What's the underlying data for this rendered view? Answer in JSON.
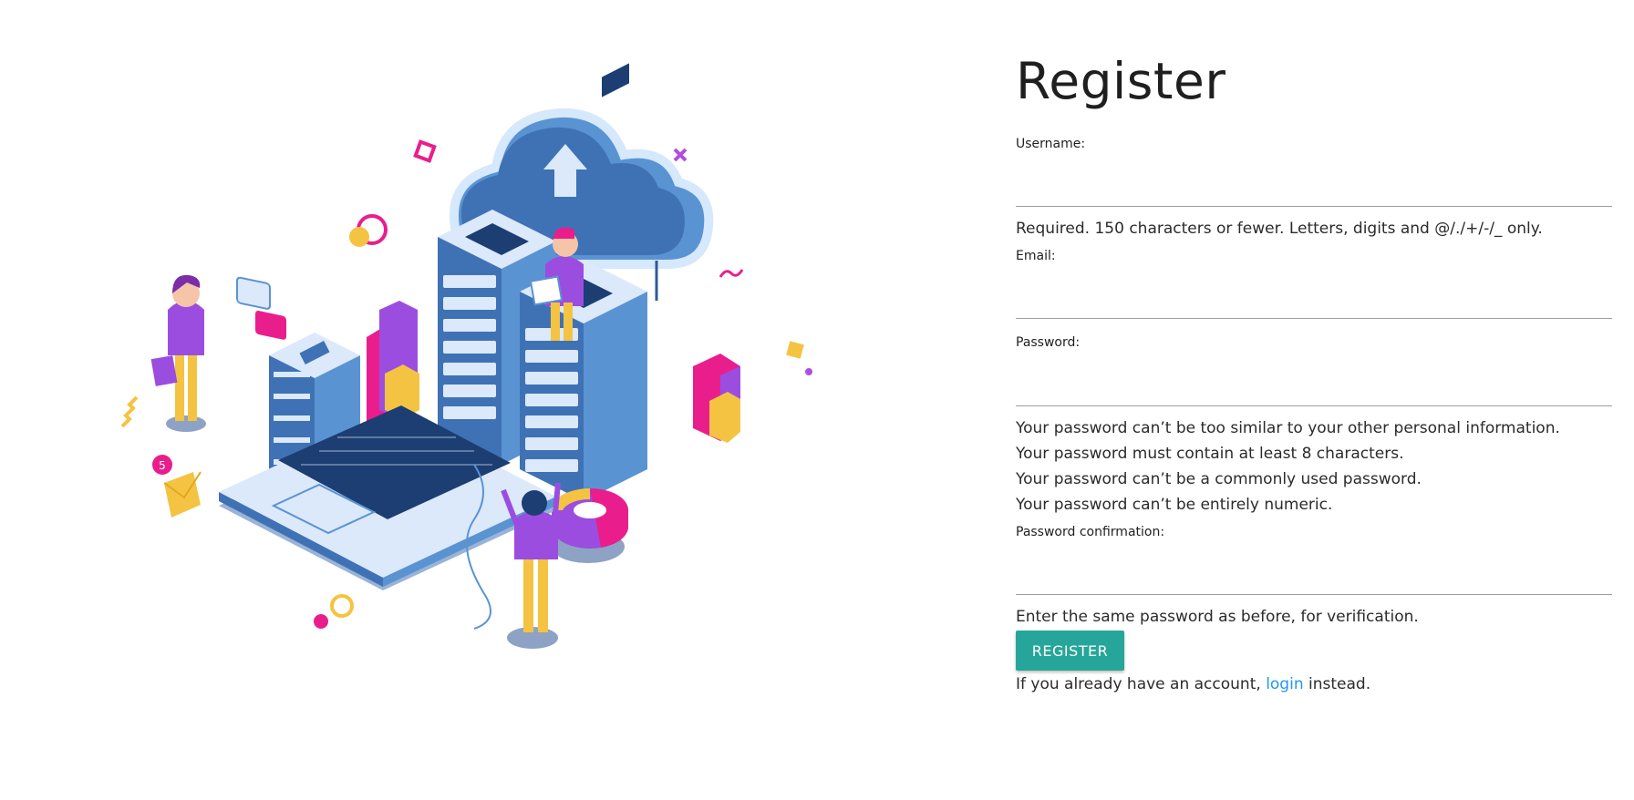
{
  "form": {
    "title": "Register",
    "username": {
      "label": "Username:",
      "value": "",
      "help": "Required. 150 characters or fewer. Letters, digits and @/./+/-/_ only."
    },
    "email": {
      "label": "Email:",
      "value": ""
    },
    "password": {
      "label": "Password:",
      "value": "",
      "help": [
        "Your password can’t be too similar to your other personal information.",
        "Your password must contain at least 8 characters.",
        "Your password can’t be a commonly used password.",
        "Your password can’t be entirely numeric."
      ]
    },
    "password_confirmation": {
      "label": "Password confirmation:",
      "value": "",
      "help": "Enter the same password as before, for verification."
    },
    "submit_label": "REGISTER",
    "login_prompt_before": "If you already have an account, ",
    "login_link_text": "login",
    "login_prompt_after": " instead."
  },
  "illustration": {
    "badge_count": "5"
  },
  "colors": {
    "accent": "#26a69a",
    "link": "#2196f3",
    "server_blue": "#3f72b5",
    "purple": "#9b4de0",
    "pink": "#e91e8c",
    "yellow": "#f5c342"
  }
}
